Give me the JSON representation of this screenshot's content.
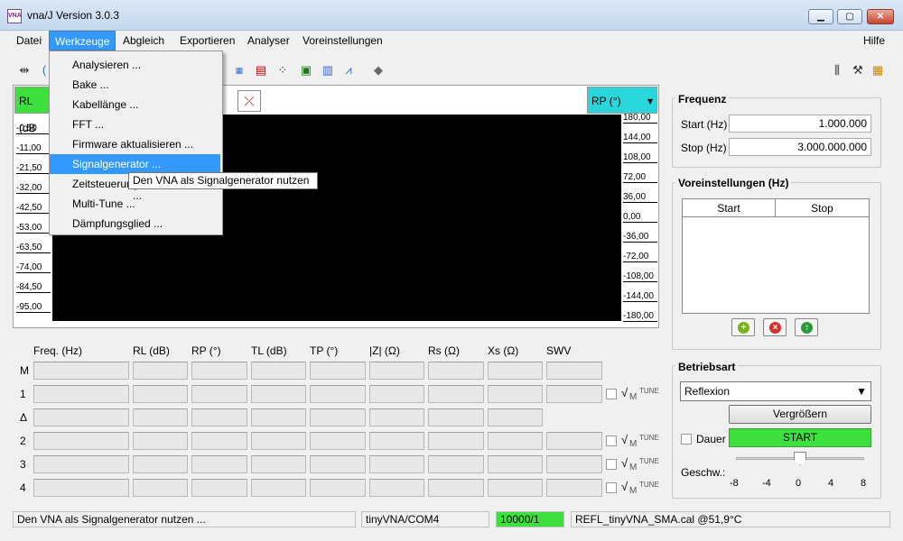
{
  "window": {
    "title": "vna/J Version 3.0.3",
    "icon_text": "VNA"
  },
  "menubar": [
    "Datei",
    "Werkzeuge",
    "Abgleich",
    "Exportieren",
    "Analyser",
    "Voreinstellungen",
    "Hilfe"
  ],
  "dropdown": {
    "items": [
      "Analysieren ...",
      "Bake ...",
      "Kabellänge ...",
      "FFT ...",
      "Firmware aktualisieren ...",
      "Signalgenerator ...",
      "Zeitsteuerung",
      "Multi-Tune ...",
      "Dämpfungsglied ..."
    ],
    "highlighted_index": 5,
    "tooltip": "Den VNA als Signalgenerator nutzen ..."
  },
  "chart": {
    "left_select": "RL (dB",
    "right_select": "RP (°)",
    "left_ticks": [
      "-0,50",
      "-11,00",
      "-21,50",
      "-32,00",
      "-42,50",
      "-53,00",
      "-63,50",
      "-74,00",
      "-84,50",
      "-95,00"
    ],
    "right_ticks": [
      "180,00",
      "144,00",
      "108,00",
      "72,00",
      "36,00",
      "0,00",
      "-36,00",
      "-72,00",
      "-108,00",
      "-144,00",
      "-180,00"
    ]
  },
  "markers": {
    "columns": [
      "Freq. (Hz)",
      "RL (dB)",
      "RP (°)",
      "TL (dB)",
      "TP (°)",
      "|Z| (Ω)",
      "Rs (Ω)",
      "Xs (Ω)",
      "SWV"
    ],
    "rows": [
      "M",
      "1",
      "Δ",
      "2",
      "3",
      "4"
    ],
    "row_extra": {
      "sqrt": "√",
      "m": "M",
      "tune": "TUNE"
    }
  },
  "frequenz": {
    "title": "Frequenz",
    "start_label": "Start (Hz)",
    "start_value": "1.000.000",
    "stop_label": "Stop (Hz)",
    "stop_value": "3.000.000.000"
  },
  "voreinstellungen": {
    "title": "Voreinstellungen (Hz)",
    "col_start": "Start",
    "col_stop": "Stop"
  },
  "betriebsart": {
    "title": "Betriebsart",
    "mode": "Reflexion",
    "zoom_button": "Vergrößern",
    "dauer_label": "Dauer",
    "start_button": "START",
    "speed_label": "Geschw.:",
    "speed_ticks": [
      "-8",
      "-4",
      "0",
      "4",
      "8"
    ],
    "speed_value": 0
  },
  "statusbar": {
    "message": "Den VNA als Signalgenerator nutzen ...",
    "device": "tinyVNA/COM4",
    "samples": "10000/1",
    "calibration": "REFL_tinyVNA_SMA.cal @51,9°C"
  },
  "colors": {
    "accent": "#3399ff",
    "green": "#3ee03e",
    "cyan": "#29d6dc",
    "plot_bg": "#000000"
  }
}
